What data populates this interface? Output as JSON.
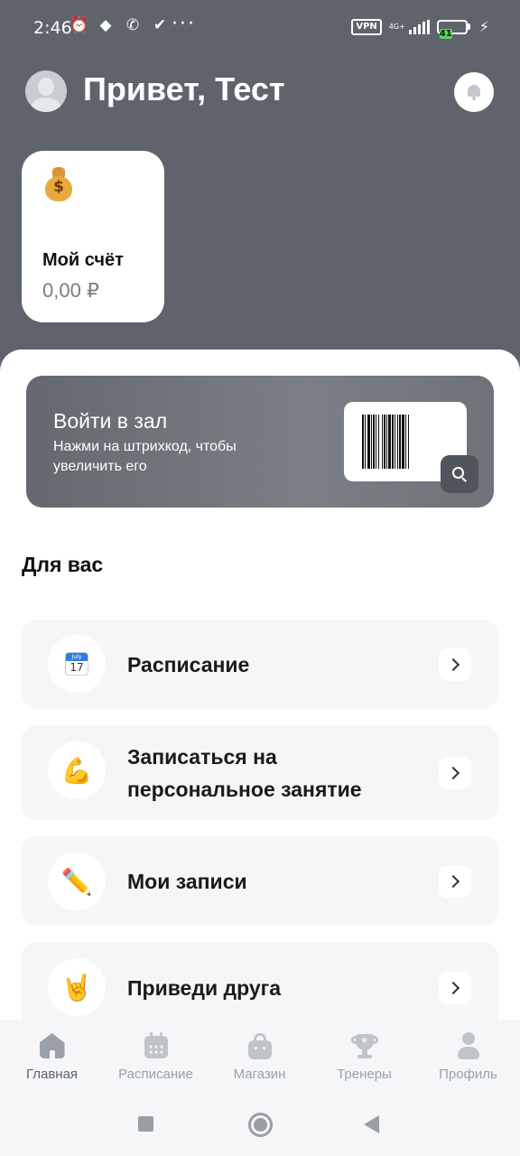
{
  "status_bar": {
    "time": "2:46",
    "vpn": "VPN",
    "network": "4G+",
    "battery": "41",
    "battery_level": 0.41
  },
  "header": {
    "greeting": "Привет, Тест"
  },
  "account": {
    "title": "Мой счёт",
    "balance": "0,00 ₽",
    "icon": "money-bag-icon"
  },
  "gym_card": {
    "title": "Войти в зал",
    "subtitle": "Нажми на штрихкод, чтобы увеличить его"
  },
  "section": {
    "title": "Для вас"
  },
  "menu": {
    "items": [
      {
        "label": "Расписание",
        "icon": "calendar-icon",
        "calendar_month": "July",
        "calendar_day": "17"
      },
      {
        "label": "Записаться на персональное занятие",
        "icon": "flexed-biceps-icon",
        "glyph": "💪"
      },
      {
        "label": "Мои записи",
        "icon": "pencil-icon",
        "glyph": "✏️"
      },
      {
        "label": "Приведи друга",
        "icon": "rock-hand-icon",
        "glyph": "🤘"
      }
    ]
  },
  "bottom_nav": {
    "items": [
      {
        "label": "Главная",
        "icon": "home-icon",
        "active": true
      },
      {
        "label": "Расписание",
        "icon": "calendar-icon",
        "active": false
      },
      {
        "label": "Магазин",
        "icon": "shopping-bag-icon",
        "active": false
      },
      {
        "label": "Тренеры",
        "icon": "trophy-icon",
        "active": false
      },
      {
        "label": "Профиль",
        "icon": "user-icon",
        "active": false
      }
    ]
  },
  "colors": {
    "header_bg": "#5f646c",
    "card_bg": "#f5f6f8",
    "battery_green": "#58d15c"
  }
}
